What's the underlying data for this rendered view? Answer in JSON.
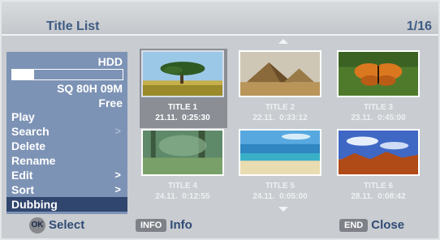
{
  "header": {
    "title": "Title List",
    "page": "1/16"
  },
  "menu": {
    "media": "HDD",
    "usage_fraction": 0.2,
    "space": "SQ 80H 09M",
    "free": "Free",
    "items": [
      {
        "label": "Play",
        "arrow": ""
      },
      {
        "label": "Search",
        "arrow": ">"
      },
      {
        "label": "Delete",
        "arrow": ""
      },
      {
        "label": "Rename",
        "arrow": ""
      },
      {
        "label": "Edit",
        "arrow": ">"
      },
      {
        "label": "Sort",
        "arrow": ">"
      },
      {
        "label": "Dubbing",
        "arrow": ""
      }
    ],
    "selected_index": 6
  },
  "titles": [
    {
      "name": "TITLE 1",
      "datetime": "21.11.  0:25:30",
      "image": "tree"
    },
    {
      "name": "TITLE 2",
      "datetime": "22.11.  0:33:12",
      "image": "pyramids"
    },
    {
      "name": "TITLE 3",
      "datetime": "23.11.  0:45:00",
      "image": "butterfly"
    },
    {
      "name": "TITLE 4",
      "datetime": "24.11.  0:12:55",
      "image": "forest"
    },
    {
      "name": "TITLE 5",
      "datetime": "24.11.  0:05:00",
      "image": "beach"
    },
    {
      "name": "TITLE 6",
      "datetime": "28.11.  0:08:42",
      "image": "sunset"
    }
  ],
  "selected_title": 0,
  "footer": {
    "ok_key": "OK",
    "ok_label": "Select",
    "info_key": "INFO",
    "info_label": "Info",
    "end_key": "END",
    "end_label": "Close"
  },
  "colors": {
    "panel": "#7d93b5",
    "selected_menu": "#30466e",
    "title_text": "#3e5c84"
  }
}
